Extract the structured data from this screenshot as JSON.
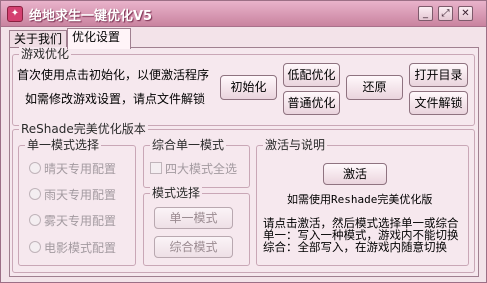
{
  "window": {
    "title": "绝地求生一键优化V5",
    "icon": "app-logo-icon",
    "controls": {
      "minimize": "_",
      "restore": "⤢",
      "close": "✕"
    }
  },
  "tabs": [
    {
      "label": "关于我们",
      "active": false
    },
    {
      "label": "优化设置",
      "active": true
    }
  ],
  "game_opt": {
    "legend": "游戏优化",
    "line1": "首次使用点击初始化，以便激活程序",
    "line2": "如需修改游戏设置，请点文件解锁",
    "buttons": {
      "init": "初始化",
      "low": "低配优化",
      "normal": "普通优化",
      "restore": "还原",
      "open_dir": "打开目录",
      "unlock": "文件解锁"
    }
  },
  "reshade": {
    "legend": "ReShade完美优化版本",
    "single": {
      "legend": "单一模式选择",
      "options": [
        "晴天专用配置",
        "雨天专用配置",
        "雾天专用配置",
        "电影模式配置"
      ]
    },
    "combo": {
      "legend": "综合单一模式",
      "checkbox": "四大模式全选"
    },
    "mode": {
      "legend": "模式选择",
      "single_btn": "单一模式",
      "combo_btn": "综合模式"
    },
    "activate": {
      "legend": "激活与说明",
      "button": "激活",
      "note": "如需使用Reshade完美优化版",
      "desc1": "请点击激活，然后模式选择单一或综合",
      "desc2": "单一：写入一种模式，游戏内不能切换",
      "desc3": "综合：全部写入，在游戏内随意切换"
    }
  }
}
